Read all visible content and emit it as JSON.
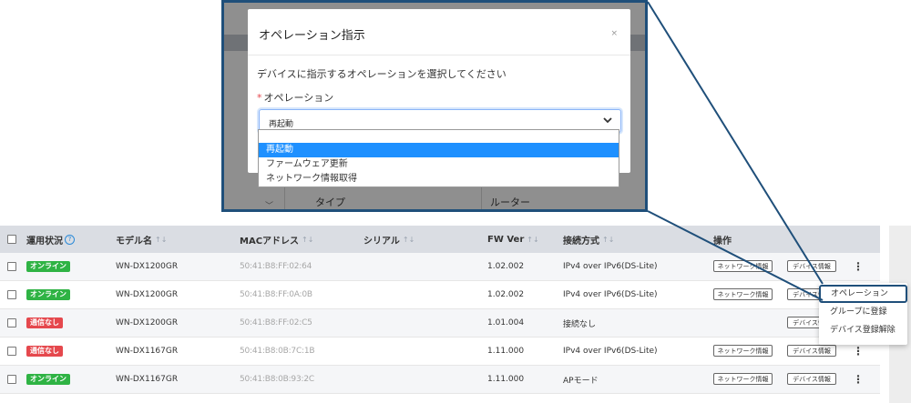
{
  "table": {
    "headers": {
      "status": "運用状況",
      "model": "モデル名",
      "mac": "MACアドレス",
      "serial": "シリアル",
      "fw": "FW Ver",
      "connection": "接続方式",
      "operation": "操作"
    },
    "help_glyph": "?",
    "sort_glyph": "↑↓",
    "rows": [
      {
        "status": "オンライン",
        "status_type": "online",
        "model": "WN-DX1200GR",
        "mac": "50:41:B8:FF:02:64",
        "serial": "",
        "fw": "1.02.002",
        "connection": "IPv4 over IPv6(DS-Lite)",
        "has_net": true
      },
      {
        "status": "オンライン",
        "status_type": "online",
        "model": "WN-DX1200GR",
        "mac": "50:41:B8:FF:0A:0B",
        "serial": "",
        "fw": "1.02.002",
        "connection": "IPv4 over IPv6(DS-Lite)",
        "has_net": true
      },
      {
        "status": "通信なし",
        "status_type": "offline",
        "model": "WN-DX1200GR",
        "mac": "50:41:B8:FF:02:C5",
        "serial": "",
        "fw": "1.01.004",
        "connection": "接続なし",
        "has_net": false
      },
      {
        "status": "通信なし",
        "status_type": "offline",
        "model": "WN-DX1167GR",
        "mac": "50:41:B8:0B:7C:1B",
        "serial": "",
        "fw": "1.11.000",
        "connection": "IPv4 over IPv6(DS-Lite)",
        "has_net": true
      },
      {
        "status": "オンライン",
        "status_type": "online",
        "model": "WN-DX1167GR",
        "mac": "50:41:B8:0B:93:2C",
        "serial": "",
        "fw": "1.11.000",
        "connection": "APモード",
        "has_net": true
      }
    ],
    "btn_network": "ネットワーク情報",
    "btn_device": "デバイス情報",
    "kebab": "⋮"
  },
  "modal": {
    "title": "オペレーション指示",
    "close": "×",
    "description": "デバイスに指示するオペレーションを選択してください",
    "required_mark": "*",
    "field_label": "オペレーション",
    "selected_value": "再起動",
    "options": [
      "",
      "再起動",
      "ファームウェア更新",
      "ネットワーク情報取得"
    ],
    "bg_column_type": "タイプ",
    "bg_column_router": "ルーター"
  },
  "context_menu": {
    "items": [
      "オペレーション",
      "グループに登録",
      "デバイス登録解除"
    ]
  },
  "colors": {
    "online": "#2fb344",
    "offline": "#e5484d",
    "accent": "#1e90ff",
    "callout": "#1f4f7a"
  }
}
